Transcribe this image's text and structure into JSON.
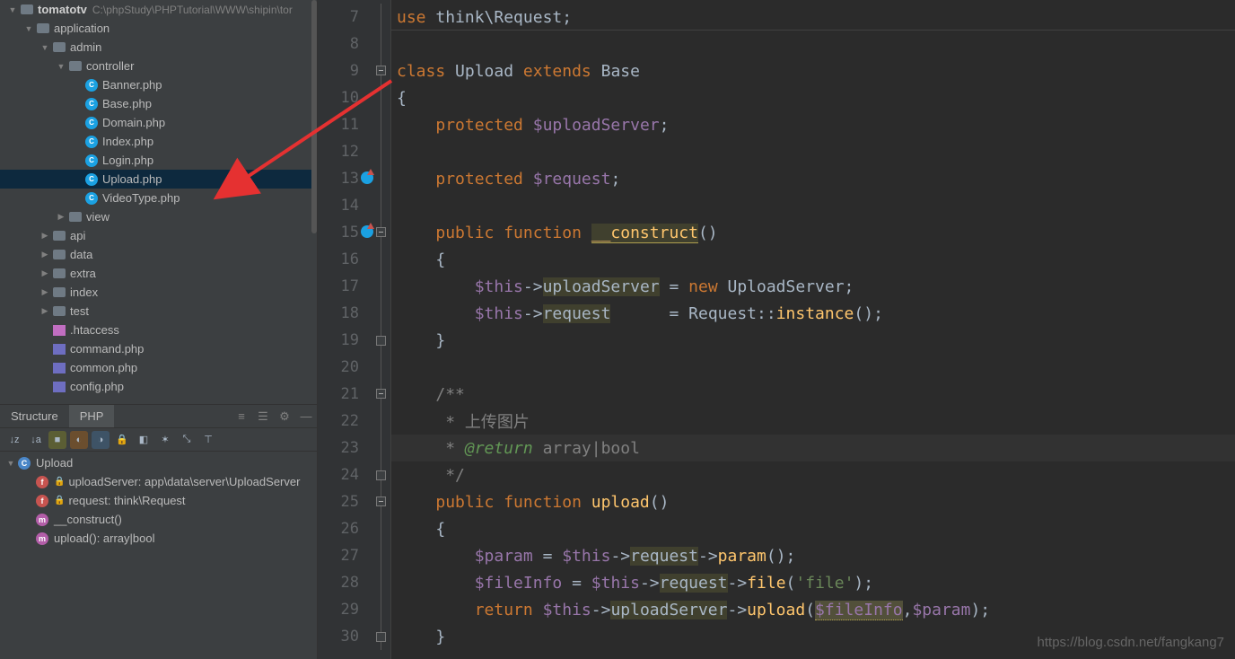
{
  "project": {
    "root_name": "tomatotv",
    "root_path": "C:\\phpStudy\\PHPTutorial\\WWW\\shipin\\tor",
    "tree": [
      {
        "depth": 0,
        "expand": "▼",
        "icon": "folder",
        "label": "tomatotv",
        "bold": true,
        "path": "C:\\phpStudy\\PHPTutorial\\WWW\\shipin\\tor",
        "selected": false
      },
      {
        "depth": 1,
        "expand": "▼",
        "icon": "folder",
        "label": "application",
        "selected": false
      },
      {
        "depth": 2,
        "expand": "▼",
        "icon": "folder",
        "label": "admin",
        "selected": false
      },
      {
        "depth": 3,
        "expand": "▼",
        "icon": "folder",
        "label": "controller",
        "selected": false
      },
      {
        "depth": 4,
        "expand": "",
        "icon": "php",
        "label": "Banner.php",
        "selected": false
      },
      {
        "depth": 4,
        "expand": "",
        "icon": "php",
        "label": "Base.php",
        "selected": false
      },
      {
        "depth": 4,
        "expand": "",
        "icon": "php",
        "label": "Domain.php",
        "selected": false
      },
      {
        "depth": 4,
        "expand": "",
        "icon": "php",
        "label": "Index.php",
        "selected": false
      },
      {
        "depth": 4,
        "expand": "",
        "icon": "php",
        "label": "Login.php",
        "selected": false
      },
      {
        "depth": 4,
        "expand": "",
        "icon": "php",
        "label": "Upload.php",
        "selected": true
      },
      {
        "depth": 4,
        "expand": "",
        "icon": "php",
        "label": "VideoType.php",
        "selected": false
      },
      {
        "depth": 3,
        "expand": "▶",
        "icon": "folder",
        "label": "view",
        "selected": false
      },
      {
        "depth": 2,
        "expand": "▶",
        "icon": "folder",
        "label": "api",
        "selected": false
      },
      {
        "depth": 2,
        "expand": "▶",
        "icon": "folder",
        "label": "data",
        "selected": false
      },
      {
        "depth": 2,
        "expand": "▶",
        "icon": "folder",
        "label": "extra",
        "selected": false
      },
      {
        "depth": 2,
        "expand": "▶",
        "icon": "folder",
        "label": "index",
        "selected": false
      },
      {
        "depth": 2,
        "expand": "▶",
        "icon": "folder",
        "label": "test",
        "selected": false
      },
      {
        "depth": 2,
        "expand": "",
        "icon": "cfg1",
        "label": ".htaccess",
        "selected": false
      },
      {
        "depth": 2,
        "expand": "",
        "icon": "cfg2",
        "label": "command.php",
        "selected": false
      },
      {
        "depth": 2,
        "expand": "",
        "icon": "cfg2",
        "label": "common.php",
        "selected": false
      },
      {
        "depth": 2,
        "expand": "",
        "icon": "cfg2",
        "label": "config.php",
        "selected": false
      }
    ]
  },
  "structure": {
    "tabs": [
      "Structure",
      "PHP"
    ],
    "active_tab": 1,
    "items": [
      {
        "icon": "c",
        "lock": "",
        "label": "Upload",
        "depth": 0,
        "expand": "▼"
      },
      {
        "icon": "f",
        "lock": "🔒",
        "label": "uploadServer: app\\data\\server\\UploadServer",
        "depth": 1,
        "expand": ""
      },
      {
        "icon": "f",
        "lock": "🔒",
        "label": "request: think\\Request",
        "depth": 1,
        "expand": ""
      },
      {
        "icon": "m",
        "lock": "",
        "label": "__construct()",
        "depth": 1,
        "expand": ""
      },
      {
        "icon": "m",
        "lock": "",
        "label": "upload(): array|bool",
        "depth": 1,
        "expand": ""
      }
    ]
  },
  "editor": {
    "current_line": 23,
    "lines": [
      {
        "n": 7,
        "fold": "bar",
        "tokens": [
          [
            "kw",
            "use "
          ],
          [
            "def",
            "think\\Request"
          ],
          [
            "op",
            ";"
          ]
        ]
      },
      {
        "n": 8,
        "fold": "bar",
        "tokens": []
      },
      {
        "n": 9,
        "fold": "minus",
        "tokens": [
          [
            "kw",
            "class "
          ],
          [
            "def",
            "Upload"
          ],
          [
            "kw",
            " extends "
          ],
          [
            "def",
            "Base"
          ]
        ]
      },
      {
        "n": 10,
        "fold": "bar",
        "tokens": [
          [
            "op",
            "{"
          ]
        ]
      },
      {
        "n": 11,
        "fold": "bar",
        "tokens": [
          [
            "pad",
            "    "
          ],
          [
            "kw",
            "protected "
          ],
          [
            "var",
            "$uploadServer"
          ],
          [
            "op",
            ";"
          ]
        ]
      },
      {
        "n": 12,
        "fold": "bar",
        "tokens": []
      },
      {
        "n": 13,
        "gmark": true,
        "fold": "bar",
        "tokens": [
          [
            "pad",
            "    "
          ],
          [
            "kw",
            "protected "
          ],
          [
            "var",
            "$request"
          ],
          [
            "op",
            ";"
          ]
        ]
      },
      {
        "n": 14,
        "fold": "bar",
        "tokens": []
      },
      {
        "n": 15,
        "gmark": true,
        "fold": "minus",
        "tokens": [
          [
            "pad",
            "    "
          ],
          [
            "kw",
            "public function "
          ],
          [
            "fn_hl",
            "__construct"
          ],
          [
            "op",
            "()"
          ]
        ]
      },
      {
        "n": 16,
        "fold": "bar",
        "tokens": [
          [
            "pad",
            "    "
          ],
          [
            "op",
            "{"
          ]
        ]
      },
      {
        "n": 17,
        "fold": "bar",
        "tokens": [
          [
            "pad",
            "        "
          ],
          [
            "var",
            "$this"
          ],
          [
            "op",
            "->"
          ],
          [
            "ident_hl",
            "uploadServer"
          ],
          [
            "op",
            " = "
          ],
          [
            "kw",
            "new "
          ],
          [
            "def",
            "UploadServer"
          ],
          [
            "op",
            ";"
          ]
        ]
      },
      {
        "n": 18,
        "fold": "bar",
        "tokens": [
          [
            "pad",
            "        "
          ],
          [
            "var",
            "$this"
          ],
          [
            "op",
            "->"
          ],
          [
            "ident_hl",
            "request"
          ],
          [
            "op",
            "      = "
          ],
          [
            "def",
            "Request"
          ],
          [
            "op",
            "::"
          ],
          [
            "fn",
            "instance"
          ],
          [
            "op",
            "();"
          ]
        ]
      },
      {
        "n": 19,
        "fold": "end",
        "tokens": [
          [
            "pad",
            "    "
          ],
          [
            "op",
            "}"
          ]
        ]
      },
      {
        "n": 20,
        "fold": "bar",
        "tokens": []
      },
      {
        "n": 21,
        "fold": "minus",
        "tokens": [
          [
            "pad",
            "    "
          ],
          [
            "cmt",
            "/**"
          ]
        ]
      },
      {
        "n": 22,
        "fold": "bar",
        "tokens": [
          [
            "pad",
            "     "
          ],
          [
            "cmt",
            "* 上传图片"
          ]
        ]
      },
      {
        "n": 23,
        "fold": "bar",
        "current": true,
        "tokens": [
          [
            "pad",
            "     "
          ],
          [
            "cmt",
            "* "
          ],
          [
            "cmt2",
            "@return"
          ],
          [
            "cmt",
            " array|bool"
          ]
        ]
      },
      {
        "n": 24,
        "fold": "end",
        "tokens": [
          [
            "pad",
            "     "
          ],
          [
            "cmt",
            "*/"
          ]
        ]
      },
      {
        "n": 25,
        "fold": "minus",
        "tokens": [
          [
            "pad",
            "    "
          ],
          [
            "kw",
            "public function "
          ],
          [
            "fn",
            "upload"
          ],
          [
            "op",
            "()"
          ]
        ]
      },
      {
        "n": 26,
        "fold": "bar",
        "tokens": [
          [
            "pad",
            "    "
          ],
          [
            "op",
            "{"
          ]
        ]
      },
      {
        "n": 27,
        "fold": "bar",
        "tokens": [
          [
            "pad",
            "        "
          ],
          [
            "var",
            "$param"
          ],
          [
            "op",
            " = "
          ],
          [
            "var",
            "$this"
          ],
          [
            "op",
            "->"
          ],
          [
            "ident_hl",
            "request"
          ],
          [
            "op",
            "->"
          ],
          [
            "fn",
            "param"
          ],
          [
            "op",
            "();"
          ]
        ]
      },
      {
        "n": 28,
        "fold": "bar",
        "tokens": [
          [
            "pad",
            "        "
          ],
          [
            "var",
            "$fileInfo"
          ],
          [
            "op",
            " = "
          ],
          [
            "var",
            "$this"
          ],
          [
            "op",
            "->"
          ],
          [
            "ident_hl",
            "request"
          ],
          [
            "op",
            "->"
          ],
          [
            "fn",
            "file"
          ],
          [
            "op",
            "("
          ],
          [
            "str",
            "'file'"
          ],
          [
            "op",
            ");"
          ]
        ]
      },
      {
        "n": 29,
        "fold": "bar",
        "tokens": [
          [
            "pad",
            "        "
          ],
          [
            "kw",
            "return "
          ],
          [
            "var",
            "$this"
          ],
          [
            "op",
            "->"
          ],
          [
            "ident_hl",
            "uploadServer"
          ],
          [
            "op",
            "->"
          ],
          [
            "fn",
            "upload"
          ],
          [
            "op",
            "("
          ],
          [
            "var_warn",
            "$fileInfo"
          ],
          [
            "op",
            ","
          ],
          [
            "var",
            "$param"
          ],
          [
            "op",
            ");"
          ]
        ]
      },
      {
        "n": 30,
        "fold": "end",
        "tokens": [
          [
            "pad",
            "    "
          ],
          [
            "op",
            "}"
          ]
        ]
      }
    ]
  },
  "watermark": "https://blog.csdn.net/fangkang7",
  "arrow_color": "#e53131"
}
